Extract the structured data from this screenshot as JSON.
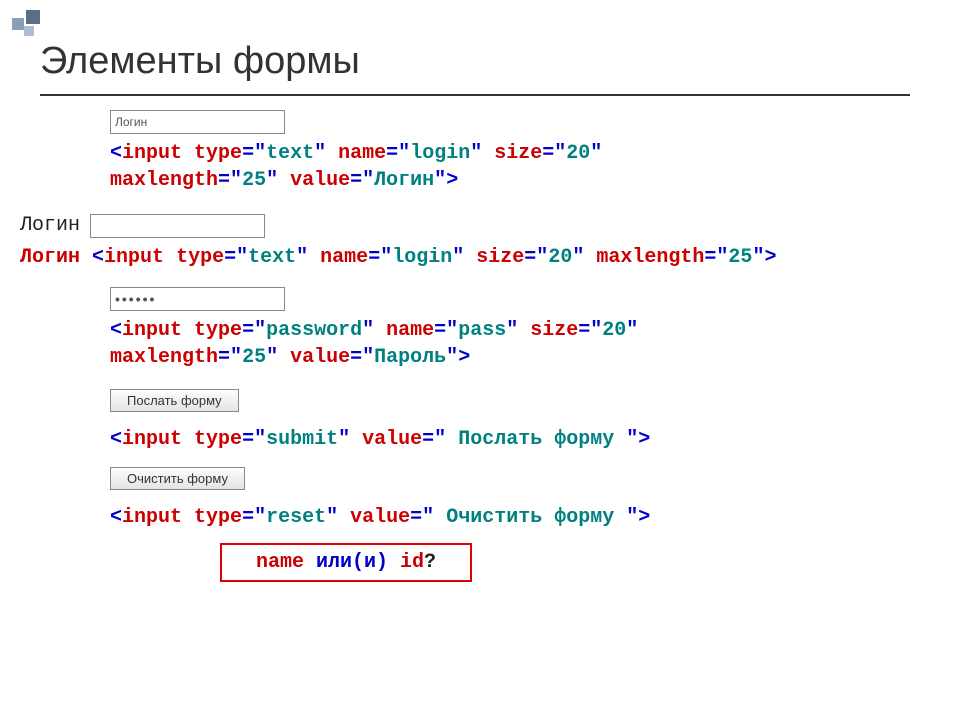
{
  "title": "Элементы формы",
  "fields": {
    "login_value": "Логин",
    "login_label": "Логин",
    "login_label2": "Логин",
    "password_mask": "••••••",
    "submit_btn": "Послать форму",
    "reset_btn": "Очистить форму"
  },
  "code": {
    "lt": "<",
    "gt": ">",
    "input": "input",
    "type": "type",
    "name_attr": "name",
    "size": "size",
    "maxlength": "maxlength",
    "value": "value",
    "eq": "=",
    "q": "\"",
    "text": "text",
    "login": "login",
    "pass": "pass",
    "password": "password",
    "submit": "submit",
    "reset": "reset",
    "sz20": "20",
    "ml25": "25",
    "val_login": "Логин",
    "val_pass": "Пароль",
    "val_submit": " Послать форму ",
    "val_reset": " Очистить форму "
  },
  "footer": {
    "name": "name",
    "or_and": " или(и) ",
    "id": "id",
    "qmark": "?"
  }
}
